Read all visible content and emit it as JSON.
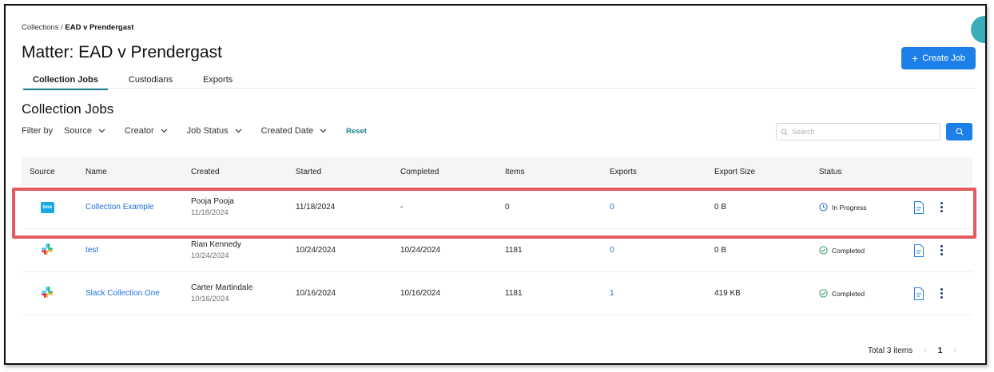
{
  "breadcrumb": {
    "parent": "Collections",
    "separator": " / ",
    "current": "EAD v Prendergast"
  },
  "page": {
    "title": "Matter: EAD v Prendergast"
  },
  "actions": {
    "create_job": "Create Job"
  },
  "tabs": [
    {
      "label": "Collection Jobs",
      "active": true
    },
    {
      "label": "Custodians",
      "active": false
    },
    {
      "label": "Exports",
      "active": false
    }
  ],
  "section": {
    "title": "Collection Jobs"
  },
  "filters": {
    "label": "Filter by",
    "items": [
      "Source",
      "Creator",
      "Job Status",
      "Created Date"
    ],
    "reset": "Reset"
  },
  "search": {
    "placeholder": "Search"
  },
  "table": {
    "columns": [
      "Source",
      "Name",
      "Created",
      "Started",
      "Completed",
      "Items",
      "Exports",
      "Export Size",
      "Status"
    ],
    "rows": [
      {
        "source": "box",
        "name": "Collection Example",
        "creator": "Pooja Pooja",
        "created_date": "11/18/2024",
        "started": "11/18/2024",
        "completed": "-",
        "items": "0",
        "exports": "0",
        "export_size": "0 B",
        "status": "In Progress"
      },
      {
        "source": "slack",
        "name": "test",
        "creator": "Rian Kennedy",
        "created_date": "10/24/2024",
        "started": "10/24/2024",
        "completed": "10/24/2024",
        "items": "1181",
        "exports": "0",
        "export_size": "0 B",
        "status": "Completed"
      },
      {
        "source": "slack",
        "name": "Slack Collection One",
        "creator": "Carter Martindale",
        "created_date": "10/16/2024",
        "started": "10/16/2024",
        "completed": "10/16/2024",
        "items": "1181",
        "exports": "1",
        "export_size": "419 KB",
        "status": "Completed"
      }
    ]
  },
  "pagination": {
    "total": "Total 3 items",
    "current_page": "1"
  },
  "colors": {
    "primary": "#1d7fe8",
    "teal": "#1a7f8c",
    "highlight": "#e25b61",
    "link": "#1d6fd8"
  },
  "icons": {
    "source_box_text": "box"
  }
}
